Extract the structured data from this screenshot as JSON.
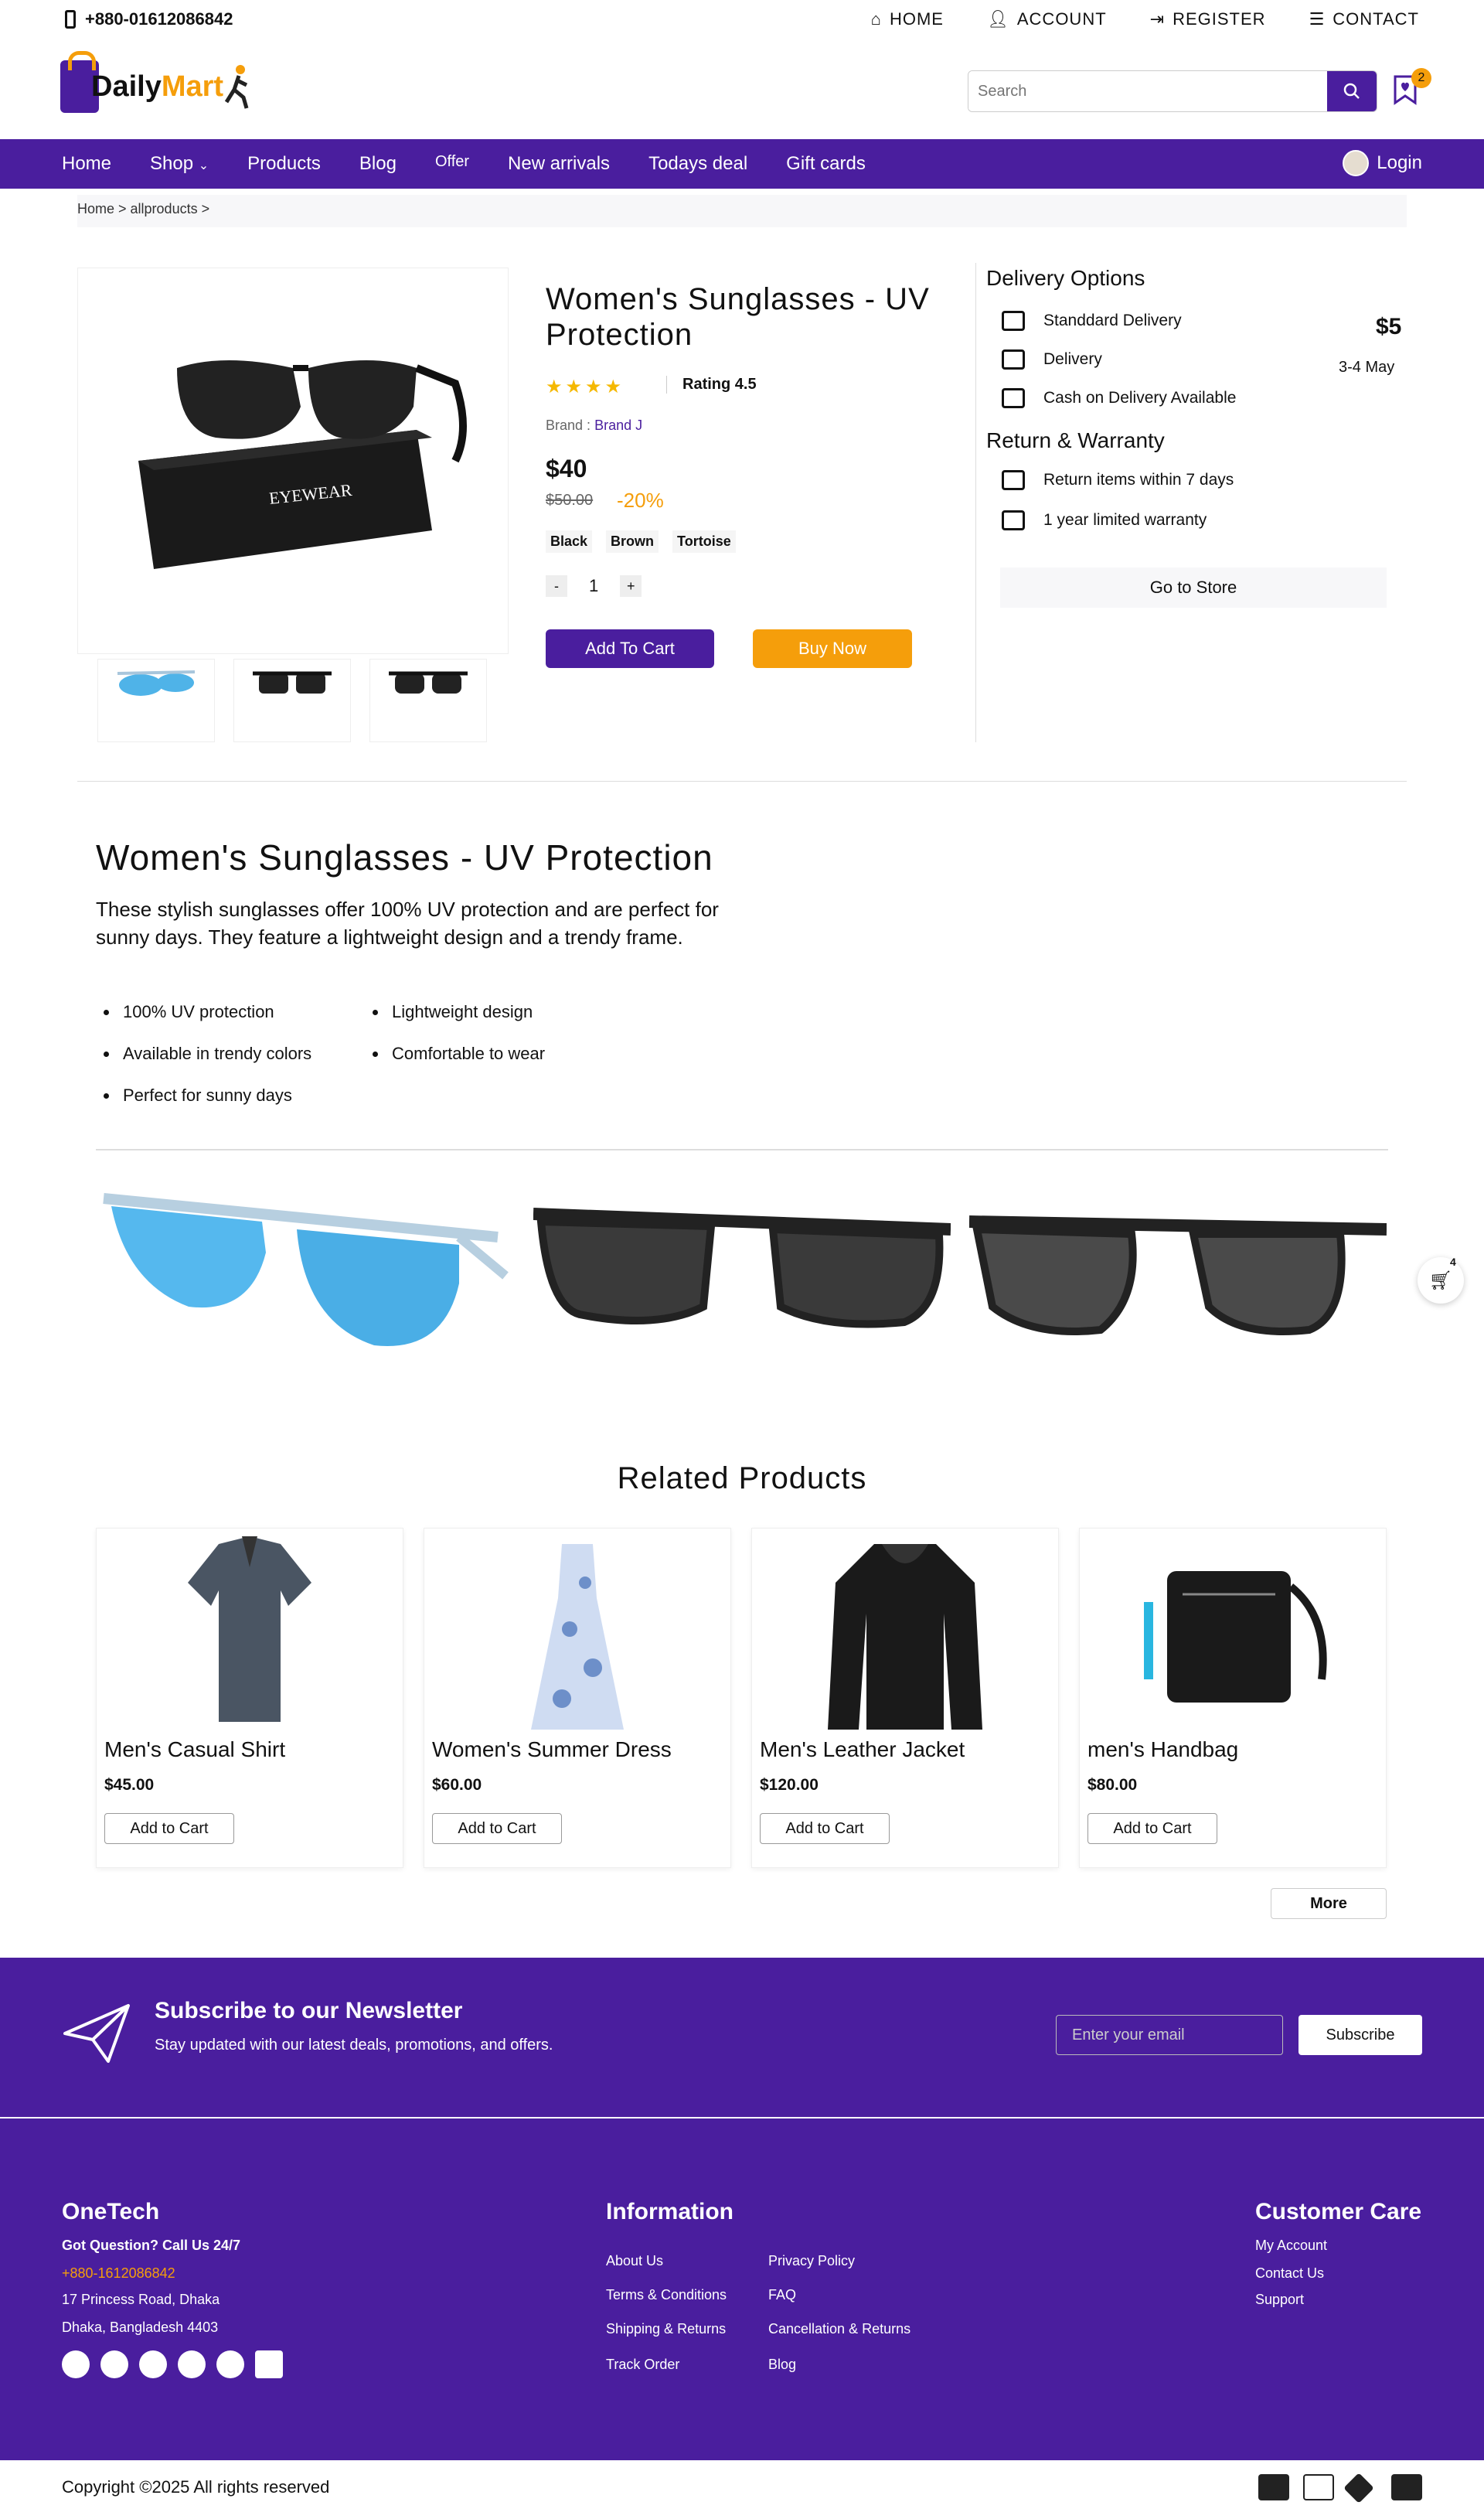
{
  "topbar": {
    "phone": "+880-01612086842",
    "links": [
      "HOME",
      "ACCOUNT",
      "REGISTER",
      "CONTACT"
    ]
  },
  "header": {
    "logo_a": "Daily",
    "logo_b": "Mart",
    "search_placeholder": "Search",
    "wishlist_count": "2"
  },
  "nav": {
    "items": [
      "Home",
      "Shop",
      "Products",
      "Blog",
      "Offer",
      "New arrivals",
      "Todays deal",
      "Gift cards"
    ],
    "login": "Login"
  },
  "breadcrumb": "Home > allproducts >",
  "product": {
    "title": "Women's Sunglasses - UV Protection",
    "rating": "Rating 4.5",
    "stars": 4.5,
    "brand_label": "Brand :",
    "brand": "Brand J",
    "price": "$40",
    "old_price": "$50.00",
    "discount": "-20%",
    "colors": [
      "Black",
      "Brown",
      "Tortoise"
    ],
    "qty": "1",
    "minus": "-",
    "plus": "+",
    "add_to_cart": "Add To Cart",
    "buy_now": "Buy Now"
  },
  "delivery": {
    "title": "Delivery Options",
    "standard": "Standdard Delivery",
    "standard_price": "$5",
    "delivery": "Delivery",
    "delivery_date": "3-4 May",
    "cod": "Cash on Delivery Available",
    "return_title": "Return & Warranty",
    "return": "Return items within 7 days",
    "warranty": "1 year limited warranty",
    "go_store": "Go to Store"
  },
  "description": {
    "title": "Women's Sunglasses - UV Protection",
    "text": "These stylish sunglasses offer 100% UV protection and are perfect for sunny days. They feature a lightweight design and a trendy frame.",
    "bullets": [
      "100% UV protection",
      "Lightweight design",
      "Available in trendy colors",
      "Comfortable to wear",
      "Perfect for sunny days"
    ]
  },
  "floating_cart_count": "4",
  "related": {
    "title": "Related Products",
    "items": [
      {
        "name": "Men's Casual Shirt",
        "price": "$45.00"
      },
      {
        "name": "Women's Summer Dress",
        "price": "$60.00"
      },
      {
        "name": "Men's Leather Jacket",
        "price": "$120.00"
      },
      {
        "name": "men's Handbag",
        "price": "$80.00"
      }
    ],
    "add": "Add to Cart",
    "more": "More"
  },
  "newsletter": {
    "title": "Subscribe to our Newsletter",
    "subtitle": "Stay updated with our latest deals, promotions, and offers.",
    "placeholder": "Enter your email",
    "button": "Subscribe"
  },
  "footer": {
    "brand": "OneTech",
    "question": "Got Question? Call Us 24/7",
    "phone": "+880-1612086842",
    "addr1": "17 Princess Road, Dhaka",
    "addr2": "Dhaka, Bangladesh 4403",
    "info_title": "Information",
    "info_a": [
      "About Us",
      "Terms & Conditions",
      "Shipping & Returns",
      "Track Order"
    ],
    "info_b": [
      "Privacy Policy",
      "FAQ",
      "Cancellation & Returns",
      "Blog"
    ],
    "care_title": "Customer Care",
    "care": [
      "My Account",
      "Contact Us",
      "Support"
    ],
    "copyright": "Copyright ©2025 All rights reserved"
  },
  "colors": {
    "primary": "#4a1e9e",
    "accent": "#f59e0b"
  }
}
